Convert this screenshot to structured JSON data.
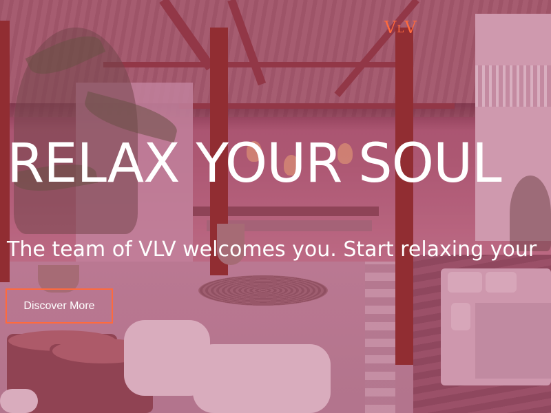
{
  "brand": {
    "logo_left": "V",
    "logo_middle": "L",
    "logo_right": "V",
    "accent_color": "#ff6a3d"
  },
  "hero": {
    "headline": "RELAX YOUR SOUL",
    "subtitle": "The team of VLV welcomes you. Start relaxing your",
    "cta_label": "Discover More",
    "overlay_color": "#a55570"
  }
}
